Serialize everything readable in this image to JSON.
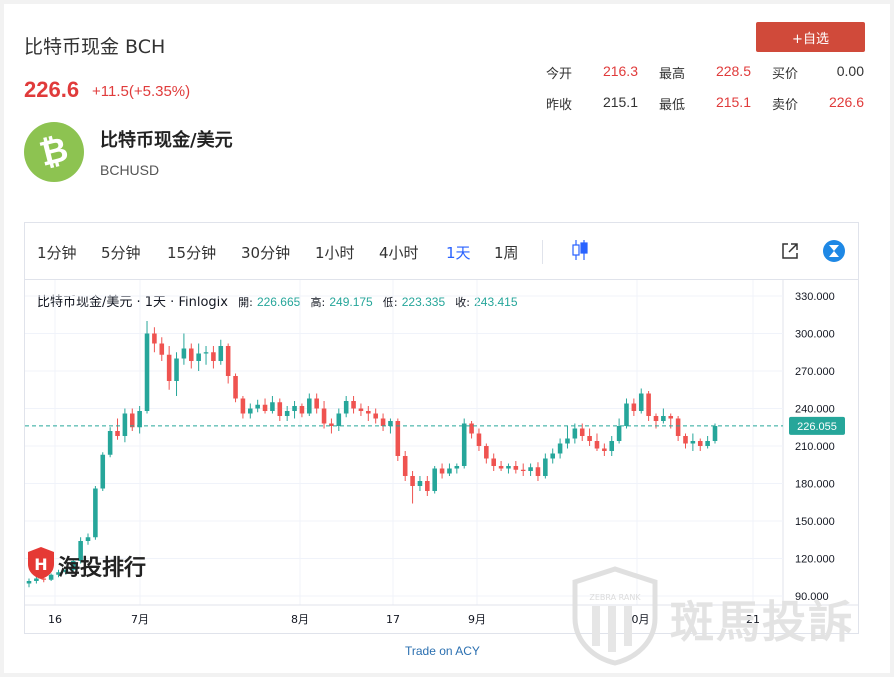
{
  "header": {
    "title": "比特币现金 BCH",
    "price": "226.6",
    "change": "+11.5(+5.35%)",
    "add_watchlist_label": "+自选"
  },
  "stats": {
    "open_label": "今开",
    "open_value": "216.3",
    "high_label": "最高",
    "high_value": "228.5",
    "bid_label": "买价",
    "bid_value": "0.00",
    "prev_close_label": "昨收",
    "prev_close_value": "215.1",
    "low_label": "最低",
    "low_value": "215.1",
    "ask_label": "卖价",
    "ask_value": "226.6"
  },
  "coin": {
    "name": "比特币现金/美元",
    "symbol": "BCHUSD",
    "logo_glyph": "₿",
    "logo_color": "#8dc351"
  },
  "toolbar": {
    "intervals": [
      "1分钟",
      "5分钟",
      "15分钟",
      "30分钟",
      "1小时",
      "4小时",
      "1天",
      "1周"
    ],
    "active_interval": "1天"
  },
  "chart_info": {
    "symbol_text": "比特币现金/美元 · 1天 · Finlogix",
    "open_label": "開:",
    "open_value": "226.665",
    "high_label": "高:",
    "high_value": "249.175",
    "low_label": "低:",
    "low_value": "223.335",
    "close_label": "收:",
    "close_value": "243.415"
  },
  "chart_data": {
    "type": "candlestick",
    "y_ticks": [
      "330.000",
      "300.000",
      "270.000",
      "240.000",
      "210.000",
      "180.000",
      "150.000",
      "120.000",
      "90.000"
    ],
    "ylim": [
      90,
      330
    ],
    "x_ticks": [
      "16",
      "7月",
      "8月",
      "17",
      "9月",
      "10月",
      "21"
    ],
    "current_price_label": "226.055",
    "current_price": 226.055,
    "up_color": "#26a69a",
    "down_color": "#ef5350",
    "grid": true,
    "candles": [
      [
        100,
        104,
        97,
        102
      ],
      [
        102,
        106,
        100,
        104
      ],
      [
        104,
        107,
        101,
        103
      ],
      [
        103,
        108,
        102,
        107
      ],
      [
        107,
        111,
        105,
        109
      ],
      [
        109,
        113,
        107,
        111
      ],
      [
        111,
        120,
        110,
        118
      ],
      [
        118,
        137,
        116,
        134
      ],
      [
        134,
        140,
        131,
        137
      ],
      [
        137,
        178,
        135,
        176
      ],
      [
        176,
        205,
        174,
        203
      ],
      [
        203,
        225,
        201,
        222
      ],
      [
        222,
        232,
        215,
        218
      ],
      [
        218,
        240,
        213,
        236
      ],
      [
        236,
        240,
        222,
        225
      ],
      [
        225,
        242,
        220,
        238
      ],
      [
        238,
        310,
        236,
        300
      ],
      [
        300,
        305,
        285,
        292
      ],
      [
        292,
        297,
        278,
        283
      ],
      [
        283,
        290,
        255,
        262
      ],
      [
        262,
        285,
        250,
        280
      ],
      [
        280,
        300,
        275,
        288
      ],
      [
        288,
        292,
        272,
        278
      ],
      [
        278,
        292,
        270,
        284
      ],
      [
        284,
        290,
        275,
        285
      ],
      [
        285,
        290,
        272,
        278
      ],
      [
        278,
        295,
        275,
        290
      ],
      [
        290,
        292,
        260,
        266
      ],
      [
        266,
        268,
        245,
        248
      ],
      [
        248,
        250,
        232,
        236
      ],
      [
        236,
        244,
        232,
        240
      ],
      [
        240,
        247,
        237,
        243
      ],
      [
        243,
        248,
        236,
        238
      ],
      [
        238,
        250,
        236,
        245
      ],
      [
        245,
        248,
        230,
        234
      ],
      [
        234,
        242,
        230,
        238
      ],
      [
        238,
        246,
        232,
        242
      ],
      [
        242,
        244,
        233,
        236
      ],
      [
        236,
        252,
        234,
        248
      ],
      [
        248,
        252,
        236,
        240
      ],
      [
        240,
        246,
        224,
        228
      ],
      [
        228,
        232,
        220,
        226
      ],
      [
        226,
        240,
        222,
        236
      ],
      [
        236,
        250,
        233,
        246
      ],
      [
        246,
        250,
        236,
        240
      ],
      [
        240,
        244,
        234,
        238
      ],
      [
        238,
        242,
        230,
        236
      ],
      [
        236,
        240,
        228,
        232
      ],
      [
        232,
        236,
        222,
        226
      ],
      [
        226,
        232,
        220,
        230
      ],
      [
        230,
        232,
        198,
        202
      ],
      [
        202,
        206,
        182,
        186
      ],
      [
        186,
        190,
        164,
        178
      ],
      [
        178,
        186,
        174,
        182
      ],
      [
        182,
        186,
        170,
        174
      ],
      [
        174,
        194,
        172,
        192
      ],
      [
        192,
        196,
        184,
        188
      ],
      [
        188,
        196,
        186,
        192
      ],
      [
        192,
        196,
        188,
        194
      ],
      [
        194,
        232,
        192,
        228
      ],
      [
        228,
        230,
        216,
        220
      ],
      [
        220,
        224,
        206,
        210
      ],
      [
        210,
        212,
        196,
        200
      ],
      [
        200,
        204,
        190,
        194
      ],
      [
        194,
        198,
        190,
        192
      ],
      [
        192,
        196,
        188,
        194
      ],
      [
        194,
        198,
        188,
        191
      ],
      [
        191,
        196,
        186,
        190
      ],
      [
        190,
        196,
        186,
        193
      ],
      [
        193,
        197,
        182,
        186
      ],
      [
        186,
        204,
        184,
        200
      ],
      [
        200,
        208,
        196,
        204
      ],
      [
        204,
        216,
        200,
        212
      ],
      [
        212,
        226,
        208,
        216
      ],
      [
        216,
        228,
        212,
        224
      ],
      [
        224,
        228,
        214,
        218
      ],
      [
        218,
        224,
        210,
        214
      ],
      [
        214,
        220,
        206,
        208
      ],
      [
        208,
        212,
        202,
        206
      ],
      [
        206,
        218,
        202,
        214
      ],
      [
        214,
        232,
        212,
        226
      ],
      [
        226,
        248,
        224,
        244
      ],
      [
        244,
        248,
        234,
        238
      ],
      [
        238,
        256,
        236,
        252
      ],
      [
        252,
        254,
        230,
        234
      ],
      [
        234,
        236,
        224,
        230
      ],
      [
        230,
        240,
        228,
        234
      ],
      [
        234,
        236,
        224,
        232
      ],
      [
        232,
        234,
        214,
        218
      ],
      [
        218,
        220,
        208,
        212
      ],
      [
        212,
        220,
        206,
        214
      ],
      [
        214,
        216,
        206,
        210
      ],
      [
        210,
        218,
        208,
        214
      ],
      [
        214,
        228,
        212,
        226
      ]
    ]
  },
  "trade_link": "Trade on ACY",
  "watermark_left": "海投排行",
  "watermark_right": "斑馬投訴",
  "watermark_badge": "ZEBRA RANK"
}
